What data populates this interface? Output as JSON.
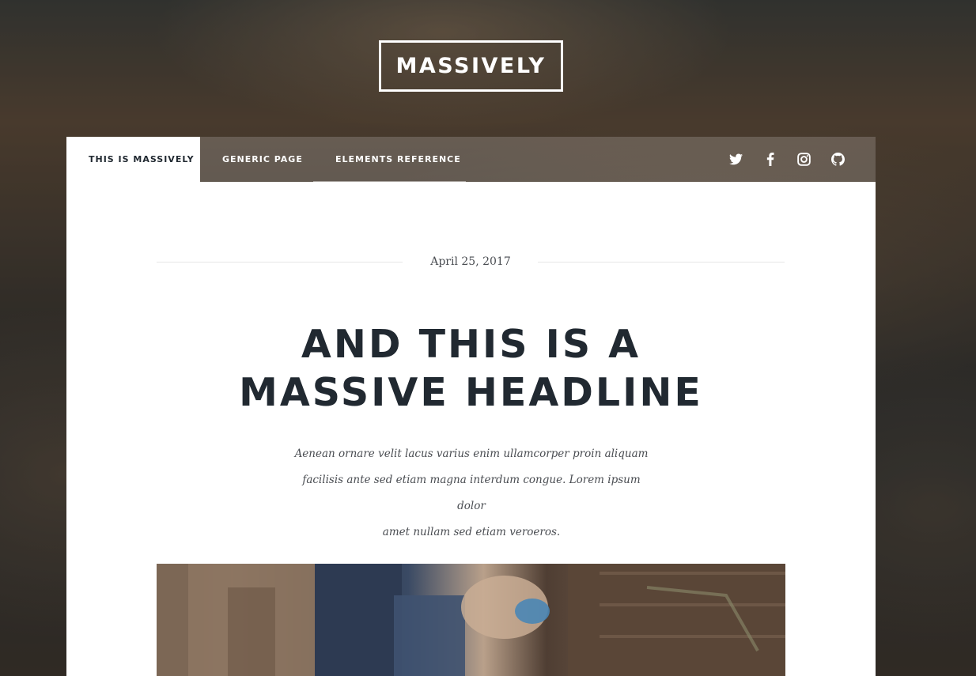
{
  "site": {
    "logo": "MASSIVELY"
  },
  "nav": {
    "links": [
      {
        "label": "This is Massively",
        "active": true
      },
      {
        "label": "Generic Page",
        "active": false
      },
      {
        "label": "Elements Reference",
        "active": false
      }
    ],
    "icons": [
      "twitter-icon",
      "facebook-icon",
      "instagram-icon",
      "github-icon"
    ]
  },
  "post": {
    "date": "April 25, 2017",
    "headline_line1": "And this is a",
    "headline_line2": "massive headline",
    "intro_line1": "Aenean ornare velit lacus varius enim ullamcorper proin aliquam",
    "intro_line2": "facilisis ante sed etiam magna interdum congue. Lorem ipsum dolor",
    "intro_line3": "amet nullam sed etiam veroeros."
  },
  "colors": {
    "heading": "#212931",
    "body_text": "#4a4d52",
    "nav_active_bg": "#ffffff",
    "nav_text": "#ffffff"
  }
}
